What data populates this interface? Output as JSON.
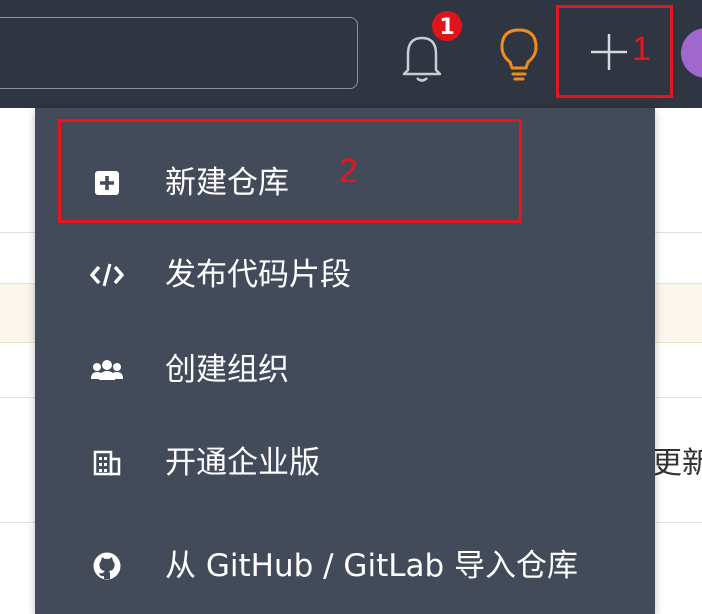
{
  "header": {
    "search": {
      "value": "",
      "placeholder": ""
    },
    "notification_count": "1",
    "create_button_annotation": "1"
  },
  "create_menu": {
    "highlight_annotation": "2",
    "items": [
      {
        "label": "新建仓库",
        "icon": "plus-square-icon"
      },
      {
        "label": "发布代码片段",
        "icon": "code-icon"
      },
      {
        "label": "创建组织",
        "icon": "group-icon"
      },
      {
        "label": "开通企业版",
        "icon": "building-icon"
      },
      {
        "label": "从 GitHub / GitLab 导入仓库",
        "icon": "github-icon"
      }
    ]
  },
  "background": {
    "partial_text": "更新"
  },
  "colors": {
    "navbar": "#2f3541",
    "dropdown": "#434a59",
    "annotation_red": "#e8141e",
    "badge_red": "#e0141a",
    "bulb_orange": "#f08c1e",
    "avatar_purple": "#a067cc"
  }
}
